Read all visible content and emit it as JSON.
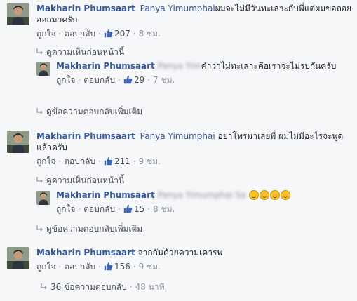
{
  "comments": [
    {
      "author": "Makharin Phumsaart",
      "mention": "Panya Yimumphai",
      "text": "ผมจะไม่มีวันทะเลาะกับพี่แต่ผมขอถอยออกมาครับ",
      "actions": {
        "like": "ถูกใจ",
        "reply": "ตอบกลับ",
        "likes": "207",
        "time": "8 ชม."
      },
      "prev_link": "ดูความเห็นก่อนหน้านี้",
      "reply": {
        "author": "Makharin Phumsaart",
        "blurred": "Panya Yim",
        "text": "คำว่าไม่ทะเลาะคือเราจะไม่รบกันครับ",
        "actions": {
          "like": "ถูกใจ",
          "reply": "ตอบกลับ",
          "likes": "29",
          "time": "7 ชม."
        }
      },
      "more_link": "ดูข้อความตอบกลับเพิ่มเติม"
    },
    {
      "author": "Makharin Phumsaart",
      "mention": "Panya Yimumphai",
      "text": "อย่าโทรมาเลยพี่ ผมไม่มีอะไรจะพูดแล้วครับ",
      "actions": {
        "like": "ถูกใจ",
        "reply": "ตอบกลับ",
        "likes": "211",
        "time": "9 ชม."
      },
      "prev_link": "ดูความเห็นก่อนหน้านี้",
      "reply": {
        "author": "Makharin Phumsaart",
        "blurred": "Panya Yimumphai Sa",
        "text": "",
        "actions": {
          "like": "ถูกใจ",
          "reply": "ตอบกลับ",
          "likes": "15",
          "time": "8 ชม."
        }
      },
      "more_link": "ดูข้อความตอบกลับเพิ่มเติม"
    },
    {
      "author": "Makharin Phumsaart",
      "text": "จากกันด้วยความเคารพ",
      "actions": {
        "like": "ถูกใจ",
        "reply": "ตอบกลับ",
        "likes": "156",
        "time": "9 ชม."
      },
      "replies_count": "36 ข้อความตอบกลับ",
      "replies_time": "48 นาที"
    }
  ],
  "colors": {
    "link": "#365899",
    "like_blue": "#4267b2",
    "meta": "#90949c",
    "background": "#f6f7f9"
  },
  "icons": [
    "like-thumb-icon",
    "reply-arrow-icon",
    "grinning-emoji-icon"
  ]
}
